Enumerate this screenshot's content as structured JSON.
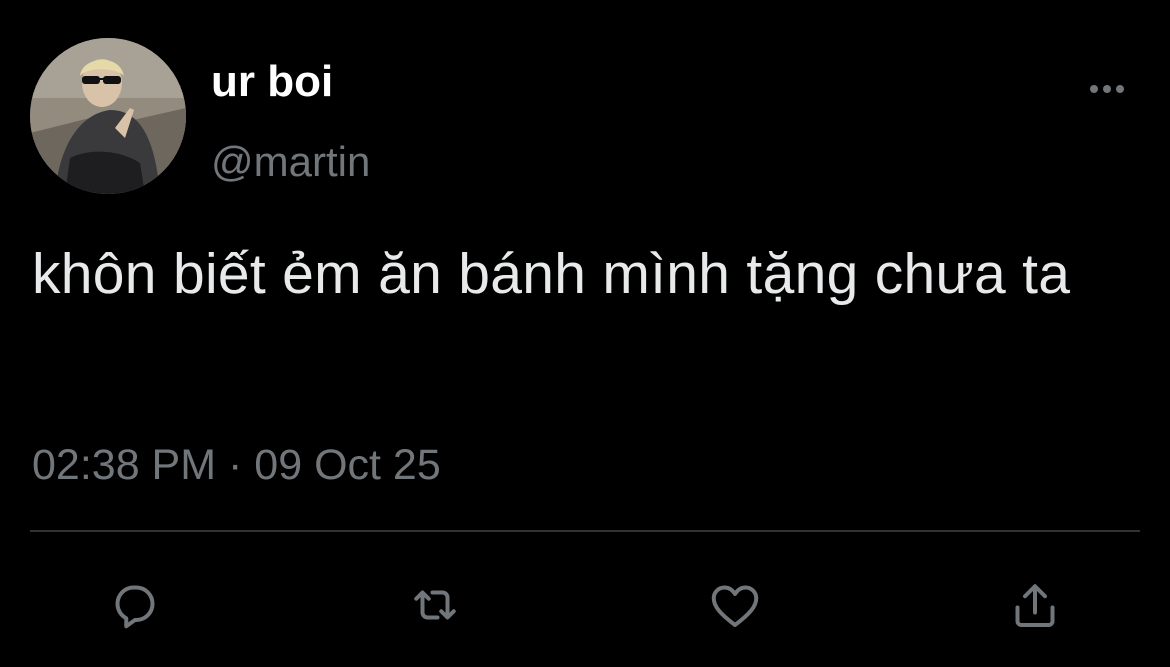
{
  "tweet": {
    "author": {
      "display_name": "ur boi",
      "handle": "@martin",
      "avatar_icon": "profile-photo"
    },
    "text": "khôn biết ẻm ăn bánh mình tặng chưa ta",
    "time": "02:38 PM",
    "separator": "·",
    "date": "09 Oct 25"
  },
  "actions": [
    {
      "icon": "reply-icon",
      "label": "Reply"
    },
    {
      "icon": "retweet-icon",
      "label": "Retweet"
    },
    {
      "icon": "like-icon",
      "label": "Like"
    },
    {
      "icon": "share-icon",
      "label": "Share"
    }
  ],
  "more_icon": "more-icon",
  "colors": {
    "background": "#000000",
    "text_primary": "#e7e9ea",
    "text_secondary": "#71767b",
    "divider": "#2f3336"
  }
}
